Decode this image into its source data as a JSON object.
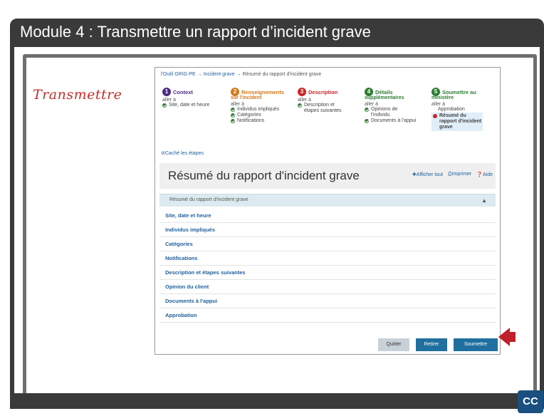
{
  "module": {
    "title": "Module 4 : Transmettre un rapport d’incident grave"
  },
  "side_label": "Transmettre",
  "breadcrumb": {
    "home": "l'Outil GRIG-PE",
    "sep1": "→",
    "incident": "Incident grave",
    "sep2": "→",
    "current": "Résumé du rapport d'incident grave"
  },
  "steps": [
    {
      "num": "1",
      "title": "Context",
      "color": "#4a2a7f",
      "goto": "aller à",
      "items": [
        "Site, date et heure"
      ]
    },
    {
      "num": "2",
      "title": "Renseignements",
      "sub": "sur l'incident",
      "color": "#d1781a",
      "goto": "aller à",
      "items": [
        "Individus impliqués",
        "Catégories",
        "Notifications"
      ]
    },
    {
      "num": "3",
      "title": "Description",
      "color": "#c62828",
      "goto": "aller à",
      "items": [
        "Description et",
        "étapes suivantes"
      ]
    },
    {
      "num": "4",
      "title": "Détails",
      "sub": "supplémentaires",
      "color": "#2e7d32",
      "goto": "aller à",
      "items": [
        "Opinions de",
        "l'individu",
        "Documents à l'appui"
      ]
    },
    {
      "num": "5",
      "title": "Soumettre au",
      "sub": "ministère",
      "color": "#2e7d32",
      "goto": "aller à",
      "items": [
        "Approbation",
        "Résumé du",
        "rapport d'incident",
        "grave"
      ]
    }
  ],
  "hide_steps": "Caché les étapes",
  "summary": {
    "title": "Résumé du rapport d'incident grave",
    "show_all": "Afficher tout",
    "print": "Imprimer",
    "help": "Aide"
  },
  "accordion": {
    "label": "Résumé du rapport d'incident grave"
  },
  "sections": [
    "Site, date et heure",
    "Individus impliqués",
    "Catégories",
    "Notifications",
    "Description et étapes suivantes",
    "Opinion du client",
    "Documents à l'appui",
    "Approbation"
  ],
  "buttons": {
    "quit": "Quitter",
    "withdraw": "Retirer",
    "submit": "Soumettre"
  },
  "cc": "CC"
}
